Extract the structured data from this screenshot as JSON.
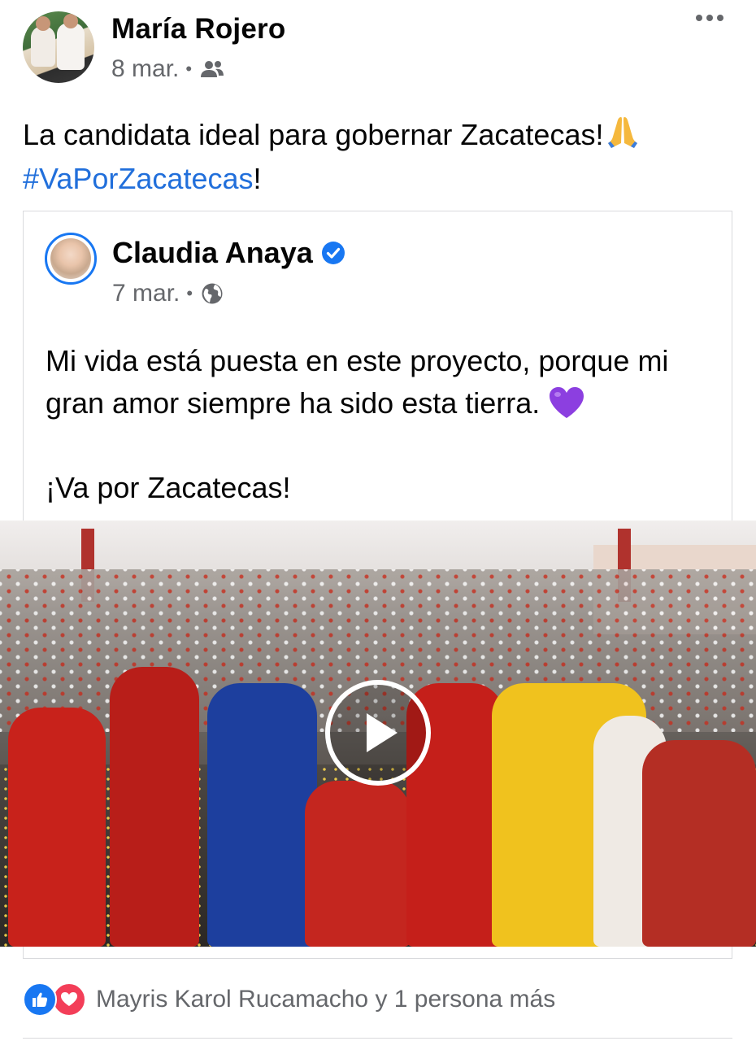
{
  "post": {
    "author": "María Rojero",
    "date": "8 mar.",
    "separator": "•",
    "audience_icon": "friends-icon",
    "more_icon": "more-horizontal-icon",
    "text": "La candidata ideal para gobernar Zacatecas!",
    "emoji": "🙏",
    "hashtag": "#VaPorZacatecas",
    "after_hashtag": "!"
  },
  "shared": {
    "author": "Claudia Anaya",
    "verified_icon": "verified-badge-icon",
    "date": "7 mar.",
    "separator": "•",
    "audience_icon": "globe-icon",
    "paragraph1": "Mi vida está puesta en este proyecto, porque mi gran amor siempre ha sido esta tierra.",
    "paragraph1_emoji": "💜",
    "paragraph2": "¡Va por Zacatecas!",
    "video": {
      "play_icon": "play-icon"
    }
  },
  "reactions": {
    "icons": [
      "like-reaction-icon",
      "love-reaction-icon"
    ],
    "text": "Mayris Karol Rucamacho y 1 persona más"
  },
  "colors": {
    "link": "#216fdb",
    "secondary_text": "#65676b",
    "like_blue": "#1877f2",
    "love_red": "#f33e58"
  }
}
